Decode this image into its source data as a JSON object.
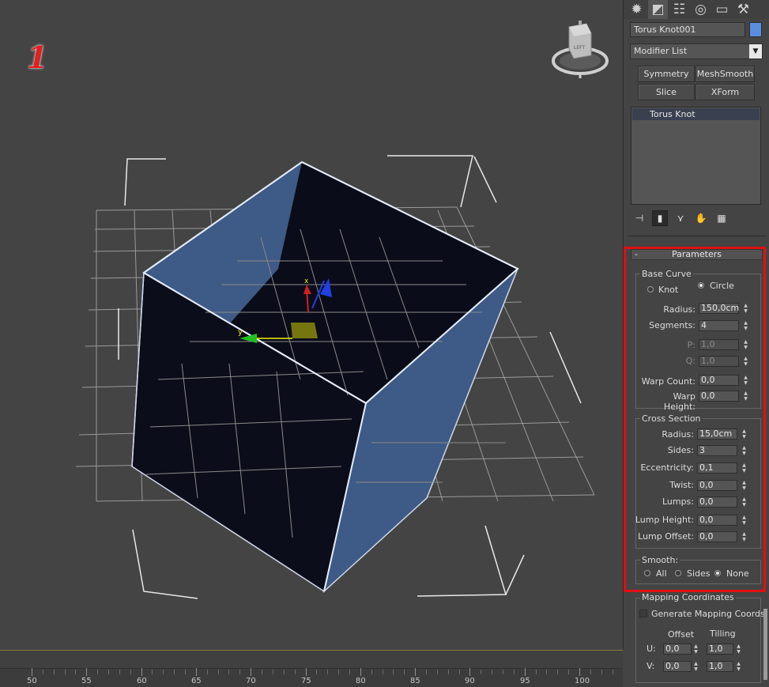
{
  "viewport": {
    "label": "1",
    "viewcube_label": "LEFT",
    "axis_x": "x",
    "axis_y": "y"
  },
  "timeline": {
    "ticks": [
      "50",
      "55",
      "60",
      "65",
      "70",
      "75",
      "80",
      "85",
      "90",
      "95",
      "100"
    ]
  },
  "panel": {
    "tabs": [
      "create-icon",
      "modify-icon",
      "hierarchy-icon",
      "motion-icon",
      "display-icon",
      "utilities-icon"
    ],
    "object_name": "Torus Knot001",
    "object_color": "#5a8fe0",
    "modifier_list": "Modifier List",
    "modifier_buttons": [
      "Symmetry",
      "MeshSmooth",
      "Slice",
      "XForm"
    ],
    "stack_item": "Torus Knot",
    "parameters": {
      "title": "Parameters",
      "collapse": "-",
      "base_curve": {
        "title": "Base Curve",
        "knot_label": "Knot",
        "circle_label": "Circle",
        "selected": "Circle",
        "radius_label": "Radius:",
        "radius": "150,0cm",
        "segments_label": "Segments:",
        "segments": "4",
        "p_label": "P:",
        "p": "1,0",
        "q_label": "Q:",
        "q": "1,0",
        "warp_count_label": "Warp Count:",
        "warp_count": "0,0",
        "warp_height_label": "Warp Height:",
        "warp_height": "0,0"
      },
      "cross_section": {
        "title": "Cross Section",
        "radius_label": "Radius:",
        "radius": "15,0cm",
        "sides_label": "Sides:",
        "sides": "3",
        "eccentricity_label": "Eccentricity:",
        "eccentricity": "0,1",
        "twist_label": "Twist:",
        "twist": "0,0",
        "lumps_label": "Lumps:",
        "lumps": "0,0",
        "lump_height_label": "Lump Height:",
        "lump_height": "0,0",
        "lump_offset_label": "Lump Offset:",
        "lump_offset": "0,0"
      },
      "smooth": {
        "title": "Smooth:",
        "all_label": "All",
        "sides_label": "Sides",
        "none_label": "None",
        "selected": "None"
      }
    },
    "mapping": {
      "title": "Mapping Coordinates",
      "generate_label": "Generate Mapping Coords",
      "generate_checked": false,
      "offset_label": "Offset",
      "tiling_label": "Tilling",
      "u_label": "U:",
      "v_label": "V:",
      "u_offset": "0,0",
      "u_tiling": "1,0",
      "v_offset": "0,0",
      "v_tiling": "1,0"
    }
  },
  "colors": {
    "highlight_box": "#e01010",
    "viewport_bg": "#444444",
    "object_face_light": "#3e5a86",
    "object_face_dark": "#0b0c1a"
  }
}
